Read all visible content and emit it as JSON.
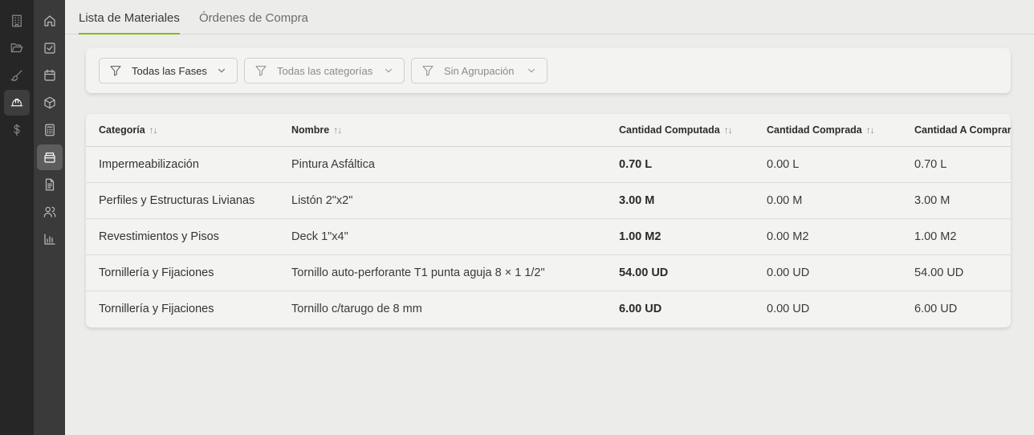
{
  "tabs": [
    {
      "label": "Lista de Materiales",
      "active": true
    },
    {
      "label": "Órdenes de Compra",
      "active": false
    }
  ],
  "filters": [
    {
      "label": "Todas las Fases",
      "muted": false
    },
    {
      "label": "Todas las categorías",
      "muted": true
    },
    {
      "label": "Sin Agrupación",
      "muted": true
    }
  ],
  "table": {
    "columns": [
      "Categoría",
      "Nombre",
      "Cantidad Computada",
      "Cantidad Comprada",
      "Cantidad A Comprar"
    ],
    "sort_glyph": "↑↓",
    "rows": [
      {
        "categoria": "Impermeabilización",
        "nombre": "Pintura Asfáltica",
        "computada": "0.70 L",
        "comprada": "0.00 L",
        "a_comprar": "0.70 L"
      },
      {
        "categoria": "Perfiles y Estructuras Livianas",
        "nombre": "Listón 2\"x2\"",
        "computada": "3.00 M",
        "comprada": "0.00 M",
        "a_comprar": "3.00 M"
      },
      {
        "categoria": "Revestimientos y Pisos",
        "nombre": "Deck 1\"x4\"",
        "computada": "1.00 M2",
        "comprada": "0.00 M2",
        "a_comprar": "1.00 M2"
      },
      {
        "categoria": "Tornillería y Fijaciones",
        "nombre": "Tornillo auto-perforante T1 punta aguja 8 × 1 1/2\"",
        "computada": "54.00 UD",
        "comprada": "0.00 UD",
        "a_comprar": "54.00 UD"
      },
      {
        "categoria": "Tornillería y Fijaciones",
        "nombre": "Tornillo c/tarugo de 8 mm",
        "computada": "6.00 UD",
        "comprada": "0.00 UD",
        "a_comprar": "6.00 UD"
      }
    ]
  },
  "rail_primary": [
    "building-icon",
    "folder-icon",
    "brush-icon",
    "helmet-icon",
    "dollar-icon"
  ],
  "rail_secondary": [
    "home-icon",
    "checklist-icon",
    "calendar-icon",
    "cube-icon",
    "calculator-icon",
    "store-icon",
    "document-icon",
    "users-icon",
    "bar-chart-icon"
  ],
  "colors": {
    "accent": "#86b817",
    "rail_dark": "#262626",
    "rail_mid": "#3a3a3a"
  }
}
